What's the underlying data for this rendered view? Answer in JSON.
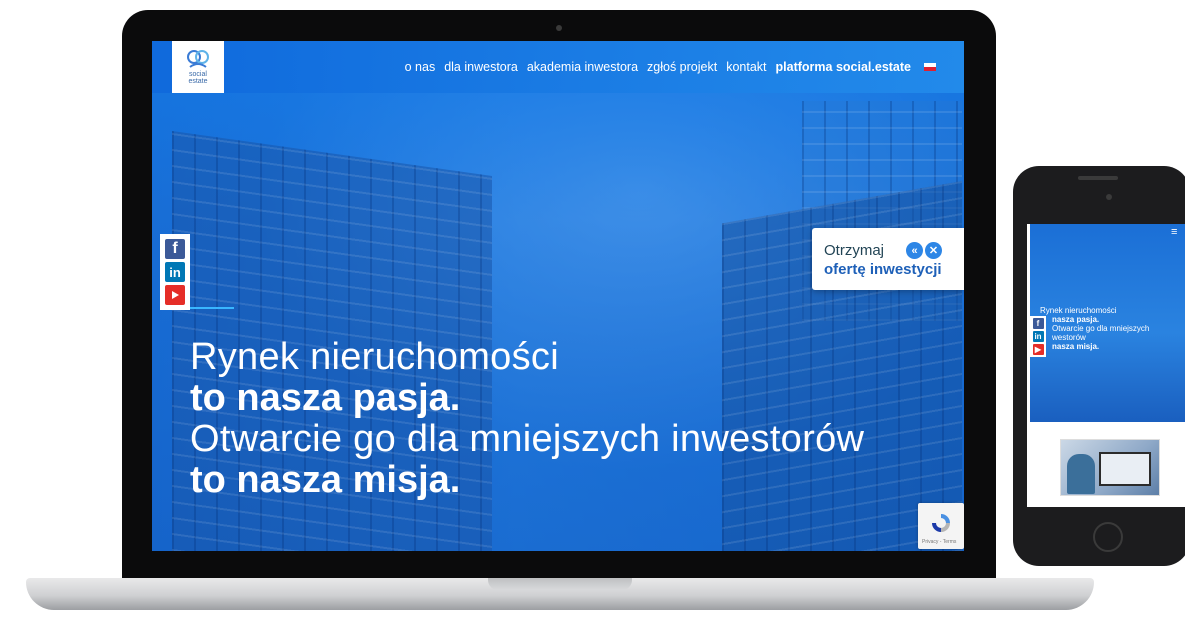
{
  "site": {
    "logo_text": "social\nestate",
    "nav": [
      {
        "label": "o nas"
      },
      {
        "label": "dla inwestora"
      },
      {
        "label": "akademia inwestora"
      },
      {
        "label": "zgłoś projekt"
      },
      {
        "label": "kontakt"
      },
      {
        "label": "platforma social.estate"
      }
    ],
    "offer": {
      "line1": "Otrzymaj",
      "line2": "ofertę inwestycji"
    },
    "hero": {
      "line1": "Rynek nieruchomości",
      "line2": "to nasza pasja.",
      "line3": "Otwarcie go dla mniejszych inwestorów",
      "line4": "to nasza misja."
    },
    "recaptcha_text": "Privacy - Terms"
  },
  "phone": {
    "hero": {
      "line1": "Rynek nieruchomości",
      "line2": "nasza pasja.",
      "line3": "Otwarcie go dla mniejszych",
      "line4": "westorów",
      "line5": "nasza misja."
    }
  },
  "colors": {
    "brand_blue": "#1e6fd6",
    "accent": "#39b6ff",
    "facebook": "#3b5998",
    "linkedin": "#0077b5",
    "youtube": "#e52d27"
  },
  "icons": [
    "facebook-icon",
    "linkedin-icon",
    "youtube-icon",
    "flag-pl-icon",
    "chevrons-left-icon",
    "close-icon",
    "menu-icon",
    "recaptcha-icon"
  ]
}
